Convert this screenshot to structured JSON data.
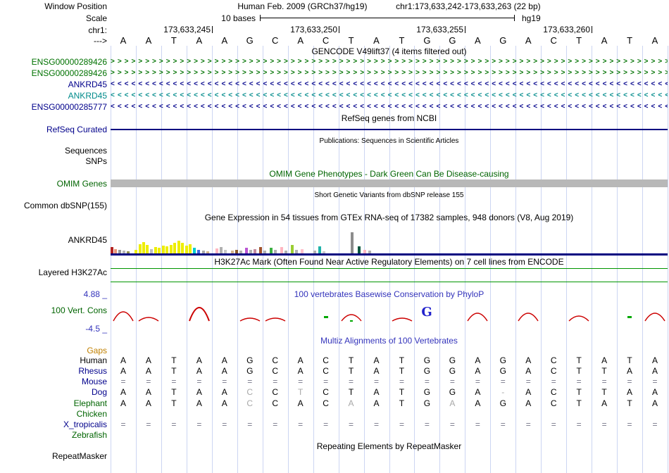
{
  "header": {
    "window_position_label": "Window Position",
    "assembly_title": "Human Feb. 2009 (GRCh37/hg19)",
    "range_title": "chr1:173,633,242-173,633,263 (22 bp)",
    "scale_label": "Scale",
    "scale_text": "10 bases",
    "assembly": "hg19",
    "chrom_label": "chr1:",
    "strand_label": "--->",
    "ticks": [
      {
        "label": "173,633,245",
        "offset": 4
      },
      {
        "label": "173,633,250",
        "offset": 9
      },
      {
        "label": "173,633,255",
        "offset": 14
      },
      {
        "label": "173,633,260",
        "offset": 19
      }
    ],
    "sequence": [
      "A",
      "A",
      "T",
      "A",
      "A",
      "G",
      "C",
      "A",
      "C",
      "T",
      "A",
      "T",
      "G",
      "G",
      "A",
      "G",
      "A",
      "C",
      "T",
      "A",
      "T",
      "A"
    ]
  },
  "tracks": {
    "gencode": {
      "title": "GENCODE V49lift37 (4 items filtered out)",
      "rows": [
        {
          "label": "ENSG00000289426",
          "color": "#007200",
          "direction": "right"
        },
        {
          "label": "ENSG00000289426",
          "color": "#007200",
          "direction": "right"
        },
        {
          "label": "ANKRD45",
          "color": "#00008b",
          "direction": "left"
        },
        {
          "label": "ANKRD45",
          "color": "#008b8b",
          "direction": "left"
        },
        {
          "label": "ENSG00000285777",
          "color": "#00008b",
          "direction": "left"
        }
      ]
    },
    "refseq": {
      "title": "RefSeq genes from NCBI",
      "label": "RefSeq Curated",
      "color": "#000080"
    },
    "publications": {
      "title": "Publications: Sequences in Scientific Articles",
      "label": "Sequences"
    },
    "snps": {
      "label": "SNPs"
    },
    "omim": {
      "title": "OMIM Gene Phenotypes - Dark Green Can Be Disease-causing",
      "label": "OMIM Genes",
      "bar_color": "#b8b8b8"
    },
    "dbsnp": {
      "title": "Short Genetic Variants from dbSNP release 155",
      "label": "Common dbSNP(155)"
    },
    "gtex": {
      "title": "Gene Expression in 54 tissues from GTEx RNA-seq of 17382 samples, 948 donors (V8, Aug 2019)",
      "label": "ANKRD45",
      "baseline_color": "#000080",
      "bars": [
        [
          0,
          9,
          "#b22222"
        ],
        [
          5,
          6,
          "#e9967a"
        ],
        [
          11,
          5,
          "#999999"
        ],
        [
          17,
          4,
          "#b5b5b5"
        ],
        [
          23,
          3,
          "#8f8f4f"
        ],
        [
          34,
          5,
          "#eeee00"
        ],
        [
          40,
          13,
          "#eeee00"
        ],
        [
          45,
          16,
          "#eeee00"
        ],
        [
          50,
          12,
          "#eeee00"
        ],
        [
          56,
          6,
          "#bdbdbd"
        ],
        [
          62,
          9,
          "#eeee00"
        ],
        [
          67,
          8,
          "#eeee00"
        ],
        [
          73,
          11,
          "#eeee00"
        ],
        [
          78,
          10,
          "#eeee00"
        ],
        [
          84,
          12,
          "#eeee00"
        ],
        [
          89,
          15,
          "#eeee00"
        ],
        [
          95,
          18,
          "#eeee00"
        ],
        [
          100,
          15,
          "#eeee00"
        ],
        [
          106,
          11,
          "#eeee00"
        ],
        [
          111,
          13,
          "#eeee00"
        ],
        [
          117,
          8,
          "#00ced1"
        ],
        [
          123,
          5,
          "#4169e1"
        ],
        [
          130,
          4,
          "#a9a9a9"
        ],
        [
          136,
          3,
          "#d2b48c"
        ],
        [
          149,
          7,
          "#ffb6c1"
        ],
        [
          155,
          9,
          "#b0b0b0"
        ],
        [
          161,
          5,
          "#c8c8c8"
        ],
        [
          171,
          4,
          "#d2b48c"
        ],
        [
          177,
          5,
          "#8b5a2b"
        ],
        [
          183,
          4,
          "#b0b0b0"
        ],
        [
          191,
          8,
          "#ba55d3"
        ],
        [
          197,
          5,
          "#b0b0b0"
        ],
        [
          203,
          6,
          "#c48aa0"
        ],
        [
          211,
          9,
          "#a0522d"
        ],
        [
          217,
          4,
          "#b0b0b0"
        ],
        [
          226,
          8,
          "#3cb043"
        ],
        [
          232,
          5,
          "#b0b0b0"
        ],
        [
          241,
          9,
          "#ffb6c1"
        ],
        [
          247,
          4,
          "#b0b0b0"
        ],
        [
          256,
          12,
          "#9acd32"
        ],
        [
          262,
          5,
          "#b0b0b0"
        ],
        [
          270,
          6,
          "#ffc0cb"
        ],
        [
          288,
          4,
          "#b0b0b0"
        ],
        [
          295,
          10,
          "#20b2aa"
        ],
        [
          301,
          3,
          "#c8c8c8"
        ],
        [
          341,
          30,
          "#8c8c8c"
        ],
        [
          351,
          10,
          "#00563f"
        ],
        [
          359,
          5,
          "#ffb6c1"
        ],
        [
          366,
          4,
          "#b0b0b0"
        ]
      ]
    },
    "h3k27ac": {
      "title": "H3K27Ac Mark (Often Found Near Active Regulatory Elements) on 7 cell lines from ENCODE",
      "label": "Layered H3K27Ac",
      "color": "#009600"
    },
    "conservation": {
      "title": "100 vertebrates Basewise Conservation by PhyloP",
      "label": "100 Vert. Cons",
      "max_label": "4.88 _",
      "min_label": "-4.5 _",
      "wiggle_color": "#cc0000",
      "glyphs": [
        {
          "col": 1,
          "kind": "arc",
          "h": 13
        },
        {
          "col": 2,
          "kind": "arc",
          "h": 5
        },
        {
          "col": 4,
          "kind": "arc",
          "h": 19
        },
        {
          "col": 6,
          "kind": "arc",
          "h": 4
        },
        {
          "col": 7,
          "kind": "arc",
          "h": 4
        },
        {
          "col": 9,
          "kind": "green"
        },
        {
          "col": 10,
          "kind": "arc",
          "h": 9,
          "green": true
        },
        {
          "col": 12,
          "kind": "arc",
          "h": 4
        },
        {
          "col": 13,
          "kind": "letter",
          "ch": "G"
        },
        {
          "col": 15,
          "kind": "arc",
          "h": 11
        },
        {
          "col": 17,
          "kind": "arc",
          "h": 11
        },
        {
          "col": 19,
          "kind": "arc",
          "h": 7
        },
        {
          "col": 21,
          "kind": "green"
        },
        {
          "col": 22,
          "kind": "arc",
          "h": 11
        }
      ]
    },
    "multiz": {
      "title": "Multiz Alignments of 100 Vertebrates",
      "rows": [
        {
          "name": "Gaps",
          "label_color": "#c08000",
          "cells": [],
          "muted": []
        },
        {
          "name": "Human",
          "label_color": "#000000",
          "cells": [
            "A",
            "A",
            "T",
            "A",
            "A",
            "G",
            "C",
            "A",
            "C",
            "T",
            "A",
            "T",
            "G",
            "G",
            "A",
            "G",
            "A",
            "C",
            "T",
            "A",
            "T",
            "A"
          ],
          "muted": []
        },
        {
          "name": "Rhesus",
          "label_color": "#00008b",
          "cells": [
            "A",
            "A",
            "T",
            "A",
            "A",
            "G",
            "C",
            "A",
            "C",
            "T",
            "A",
            "T",
            "G",
            "G",
            "A",
            "G",
            "A",
            "C",
            "T",
            "T",
            "A",
            "A"
          ],
          "muted": []
        },
        {
          "name": "Mouse",
          "label_color": "#00008b",
          "cells": [
            "=",
            "=",
            "=",
            "=",
            "=",
            "=",
            "=",
            "=",
            "=",
            "=",
            "=",
            "=",
            "=",
            "=",
            "=",
            "=",
            "=",
            "=",
            "=",
            "=",
            "=",
            "="
          ],
          "muted": "all"
        },
        {
          "name": "Dog",
          "label_color": "#00008b",
          "cells": [
            "A",
            "A",
            "T",
            "A",
            "A",
            "C",
            "C",
            "T",
            "C",
            "T",
            "A",
            "T",
            "G",
            "G",
            "A",
            "-",
            "A",
            "C",
            "T",
            "T",
            "A",
            "A"
          ],
          "muted": [
            5,
            7,
            15
          ]
        },
        {
          "name": "Elephant",
          "label_color": "#006400",
          "cells": [
            "A",
            "A",
            "T",
            "A",
            "A",
            "C",
            "C",
            "A",
            "C",
            "A",
            "A",
            "T",
            "G",
            "A",
            "A",
            "G",
            "A",
            "C",
            "T",
            "A",
            "T",
            "A"
          ],
          "muted": [
            5,
            9,
            13
          ]
        },
        {
          "name": "Chicken",
          "label_color": "#006400",
          "cells": [],
          "muted": []
        },
        {
          "name": "X_tropicalis",
          "label_color": "#00008b",
          "cells": [
            "=",
            "=",
            "=",
            "=",
            "=",
            "=",
            "=",
            "=",
            "=",
            "=",
            "=",
            "=",
            "=",
            "=",
            "=",
            "=",
            "=",
            "=",
            "=",
            "=",
            "=",
            "="
          ],
          "muted": "all"
        },
        {
          "name": "Zebrafish",
          "label_color": "#006400",
          "cells": [],
          "muted": []
        }
      ]
    },
    "repeatmasker": {
      "title": "Repeating Elements by RepeatMasker",
      "label": "RepeatMasker"
    }
  }
}
